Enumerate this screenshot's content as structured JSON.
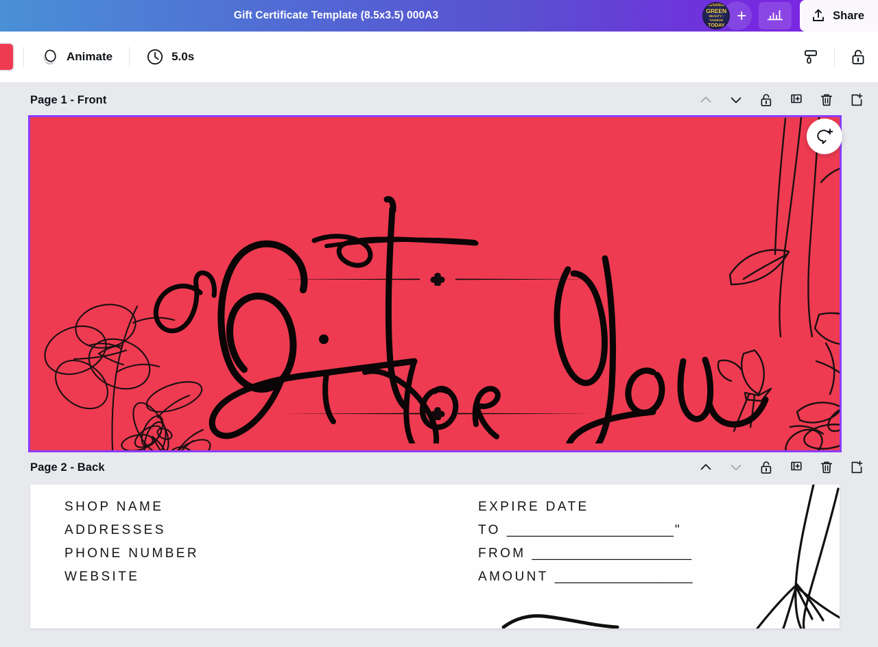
{
  "topbar": {
    "title": "Gift Certificate Template (8.5x3.5) 000A3",
    "avatar_lines": [
      "ALEXANDER",
      "GREEN",
      "BEAUTY • FASHION",
      "TODAY"
    ],
    "add_label": "+",
    "share_label": "Share",
    "gradient_start": "#4a90d6",
    "gradient_end": "#8126e8",
    "icons": {
      "avatar": "user-avatar",
      "add": "plus-icon",
      "analytics": "bar-chart-icon",
      "share": "share-upload-icon"
    }
  },
  "toolbar": {
    "color_swatch": "#ee3b51",
    "animate_label": "Animate",
    "duration_label": "5.0s",
    "icons": {
      "animate": "animate-icon",
      "clock": "clock-icon",
      "copy_style": "paint-roller-icon",
      "lock": "unlocked-padlock-icon"
    }
  },
  "pages": [
    {
      "label": "Page 1 - Front",
      "selected": true,
      "move_up_enabled": false,
      "move_down_enabled": true,
      "design": {
        "background": "#ee3b51",
        "script_text": "a Gift for You",
        "divider_top": "ornamental-divider",
        "divider_bottom": "ornamental-divider",
        "art": [
          "floral-line-art-left",
          "floral-line-art-right"
        ]
      }
    },
    {
      "label": "Page 2 - Back",
      "selected": false,
      "move_up_enabled": true,
      "move_down_enabled": false,
      "design": {
        "background": "#fefefe",
        "left_lines": [
          "SHOP NAME",
          "ADDRESSES",
          "PHONE NUMBER",
          "WEBSITE"
        ],
        "right_lines": [
          {
            "label": "EXPIRE DATE",
            "rule": "",
            "suffix": ""
          },
          {
            "label": "TO",
            "rule": "_______________________",
            "suffix": "\""
          },
          {
            "label": "FROM",
            "rule": "______________________",
            "suffix": ""
          },
          {
            "label": "AMOUNT",
            "rule": "___________________",
            "suffix": ""
          }
        ],
        "art": [
          "stem-line-art-right"
        ]
      }
    }
  ],
  "page_tools": {
    "move_up": "chevron-up-icon",
    "move_down": "chevron-down-icon",
    "lock": "unlocked-padlock-icon",
    "duplicate": "duplicate-page-icon",
    "delete": "trash-icon",
    "add_page": "add-page-icon"
  },
  "comment_fab": {
    "icon": "add-comment-icon"
  }
}
